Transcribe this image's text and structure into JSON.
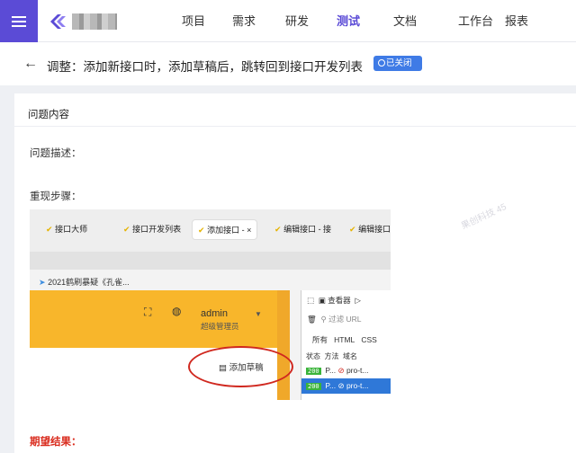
{
  "nav": {
    "items": [
      "项目",
      "需求",
      "研发",
      "测试",
      "文档",
      "工作台",
      "报表"
    ],
    "active_index": 3
  },
  "header": {
    "back_icon": "←",
    "title": "调整：添加新接口时，添加草稿后，跳转回到接口开发列表",
    "status": "已关闭"
  },
  "card": {
    "section_title": "问题内容",
    "description_label": "问题描述：",
    "steps_label": "重现步骤：",
    "expected_label": "期望结果："
  },
  "screenshot": {
    "tabs": [
      "接口大师",
      "接口开发列表",
      "添加接口 -",
      "编辑接口 - 接",
      "编辑接口"
    ],
    "tab_close": "×",
    "bookmark": "2021鹤刷暴疑《孔雀...",
    "user_name": "admin",
    "user_role": "超级管理员",
    "draft_button": "添加草稿",
    "devtools": {
      "inspector": "查看器",
      "filter_placeholder": "过滤 URL",
      "filters": [
        "所有",
        "HTML",
        "CSS"
      ],
      "headers": [
        "状态",
        "方法",
        "域名"
      ],
      "rows": [
        {
          "status": "200",
          "method": "P...",
          "domain": "pro-t..."
        },
        {
          "status": "200",
          "method": "P...",
          "domain": "pro-t..."
        }
      ]
    }
  },
  "watermark_text": "果创科技 45",
  "colors": {
    "brand": "#5b4bd6",
    "badge": "#3f7be6",
    "highlight": "#d0281f",
    "orange": "#f8b62b"
  }
}
